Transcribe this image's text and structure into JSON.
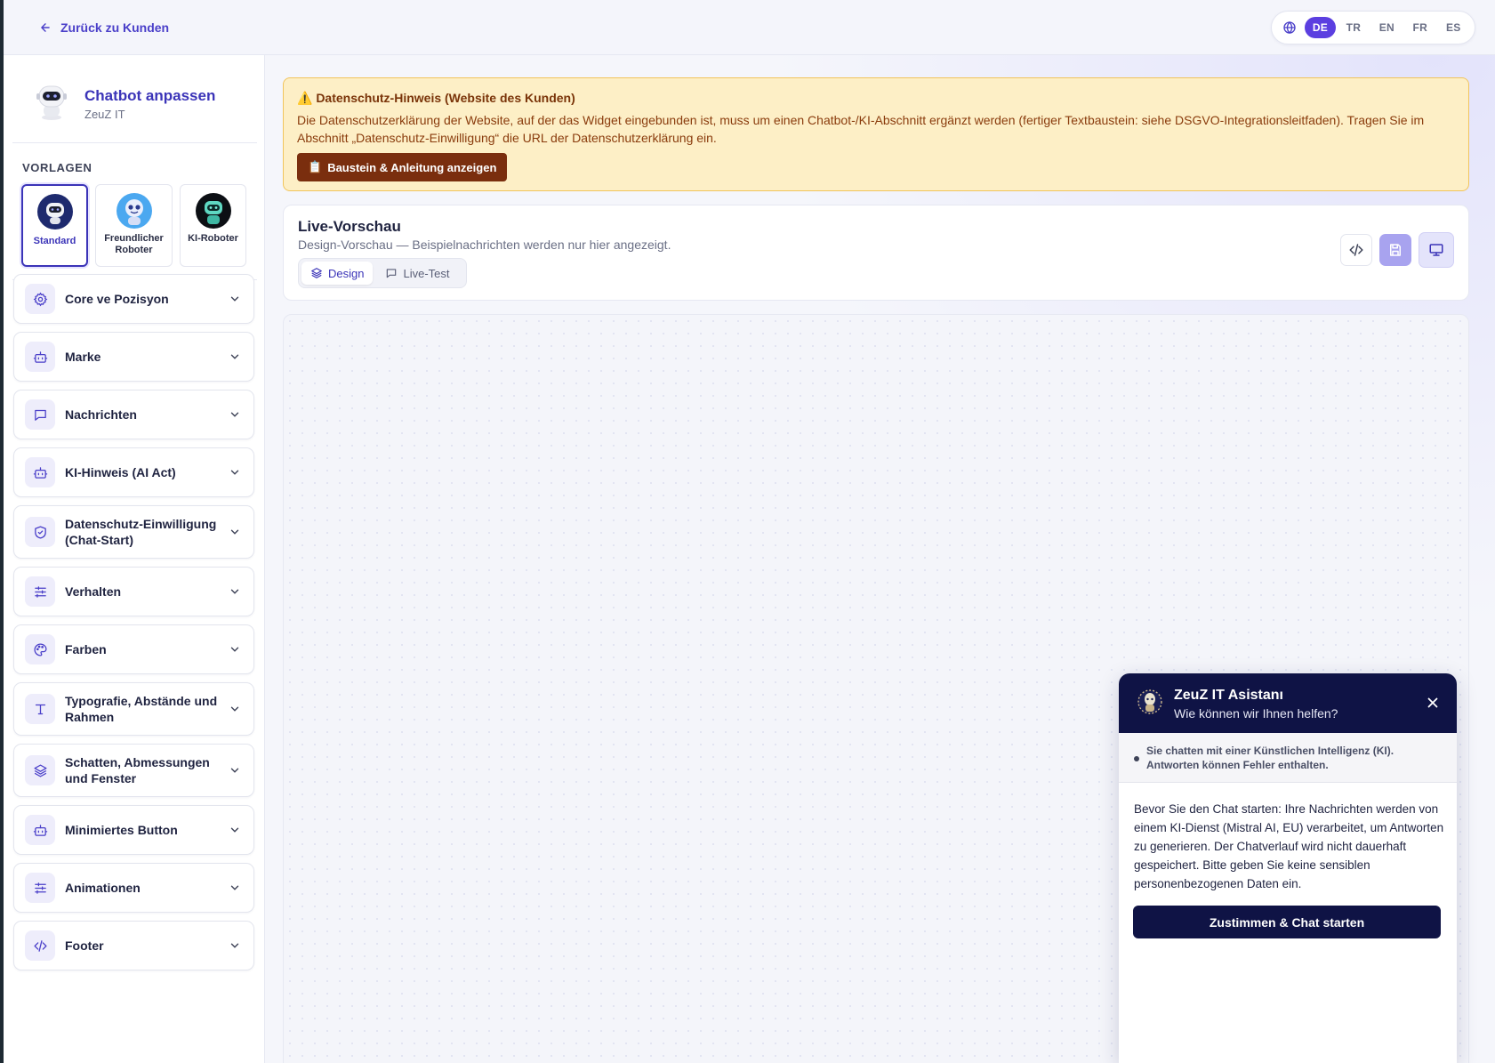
{
  "topbar": {
    "back_label": "Zurück zu Kunden",
    "languages": [
      "DE",
      "TR",
      "EN",
      "FR",
      "ES"
    ],
    "active_language": "DE"
  },
  "sidebar": {
    "title": "Chatbot anpassen",
    "subtitle": "ZeuZ IT",
    "templates_label": "VORLAGEN",
    "templates": [
      {
        "name": "Standard",
        "selected": true
      },
      {
        "name": "Freundlicher Roboter",
        "selected": false
      },
      {
        "name": "KI-Roboter",
        "selected": false
      }
    ],
    "sections": [
      {
        "label": "Core ve Pozisyon",
        "icon": "gear-icon"
      },
      {
        "label": "Marke",
        "icon": "bot-icon"
      },
      {
        "label": "Nachrichten",
        "icon": "message-icon"
      },
      {
        "label": "KI-Hinweis (AI Act)",
        "icon": "bot-icon"
      },
      {
        "label": "Datenschutz-Einwilligung (Chat-Start)",
        "icon": "shield-icon"
      },
      {
        "label": "Verhalten",
        "icon": "sliders-icon"
      },
      {
        "label": "Farben",
        "icon": "palette-icon"
      },
      {
        "label": "Typografie, Abstände und Rahmen",
        "icon": "type-icon"
      },
      {
        "label": "Schatten, Abmessungen und Fenster",
        "icon": "layers-icon"
      },
      {
        "label": "Minimiertes Button",
        "icon": "bot-icon"
      },
      {
        "label": "Animationen",
        "icon": "sliders-icon"
      },
      {
        "label": "Footer",
        "icon": "code-icon"
      }
    ]
  },
  "notice": {
    "title": "⚠️ Datenschutz-Hinweis (Website des Kunden)",
    "text": "Die Datenschutzerklärung der Website, auf der das Widget eingebunden ist, muss um einen Chatbot-/KI-Abschnitt ergänzt werden (fertiger Textbaustein: siehe DSGVO-Integrationsleitfaden). Tragen Sie im Abschnitt „Datenschutz-Einwilligung“ die URL der Datenschutzerklärung ein.",
    "button_label": "Baustein & Anleitung anzeigen",
    "button_icon": "📋"
  },
  "preview": {
    "title": "Live-Vorschau",
    "subtitle": "Design-Vorschau — Beispielnachrichten werden nur hier angezeigt.",
    "tabs": [
      {
        "label": "Design",
        "active": true
      },
      {
        "label": "Live-Test",
        "active": false
      }
    ]
  },
  "chat": {
    "name": "ZeuZ IT Asistanı",
    "tagline": "Wie können wir Ihnen helfen?",
    "ai_notice": "Sie chatten mit einer Künstlichen Intelligenz (KI). Antworten können Fehler enthalten.",
    "consent_text": "Bevor Sie den Chat starten: Ihre Nachrichten werden von einem KI-Dienst (Mistral AI, EU) verarbeitet, um Antworten zu generieren. Der Chatverlauf wird nicht dauerhaft gespeichert. Bitte geben Sie keine sensiblen personenbezogenen Daten ein.",
    "consent_button": "Zustimmen & Chat starten"
  },
  "colors": {
    "accent": "#5b3fe0",
    "brand_dark": "#0f1345",
    "notice_bg": "#fdefc6",
    "notice_button": "#7a2e0e"
  }
}
